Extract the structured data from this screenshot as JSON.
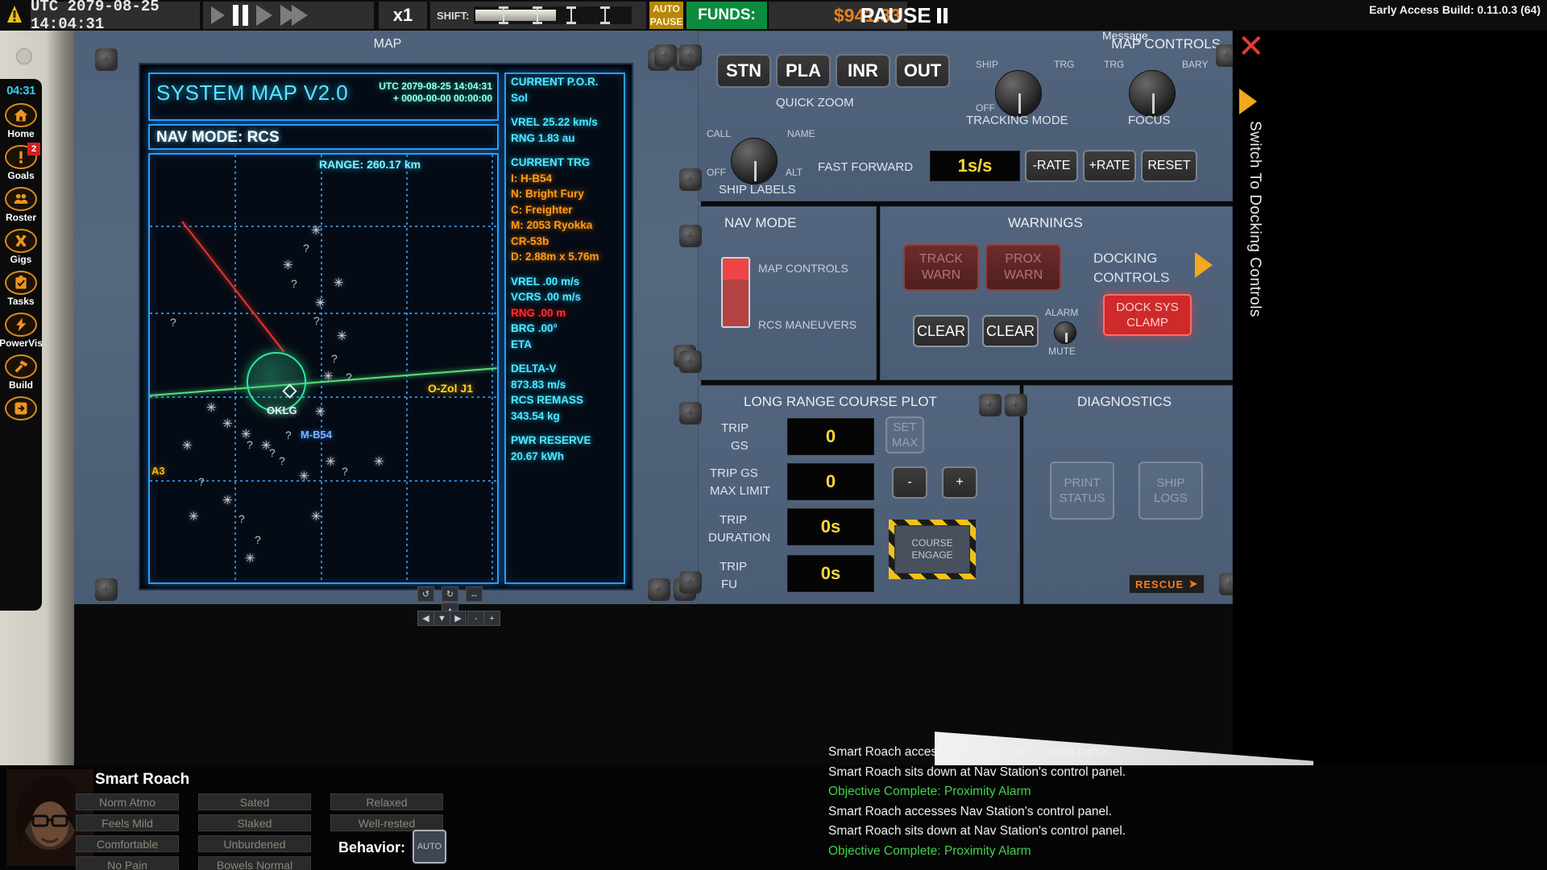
{
  "topbar": {
    "warn_icon": "warning-bell-icon",
    "clock": "UTC 2079-08-25 14:04:31",
    "speed": "x1",
    "shift_label": "SHIFT:",
    "auto_pause_line1": "AUTO",
    "auto_pause_line2": "PAUSE",
    "funds_label": "FUNDS:",
    "money": "$941.83",
    "pause_label": "PAUSE",
    "build": "Early Access Build: 0.11.0.3 (64)"
  },
  "sidebar": {
    "clock": "04:31",
    "items": [
      {
        "label": "Home",
        "icon": "home-icon",
        "badge": ""
      },
      {
        "label": "Goals",
        "icon": "exclamation-icon",
        "badge": "2"
      },
      {
        "label": "Roster",
        "icon": "people-icon",
        "badge": ""
      },
      {
        "label": "Gigs",
        "icon": "x-mark-icon",
        "badge": ""
      },
      {
        "label": "Tasks",
        "icon": "clipboard-check-icon",
        "badge": ""
      },
      {
        "label": "PowerVis",
        "icon": "lightning-icon",
        "badge": ""
      },
      {
        "label": "Build",
        "icon": "hammer-icon",
        "badge": ""
      },
      {
        "label": "",
        "icon": "exit-arrow-icon",
        "badge": ""
      }
    ]
  },
  "map": {
    "panel_title": "MAP",
    "screen_title": "SYSTEM MAP V2.0",
    "utc_tag": "UTC",
    "utc_value": "2079-08-25 14:04:31",
    "plus_tag": "+",
    "plus_value": "0000-00-00 00:00:00",
    "nav_mode": "NAV MODE: RCS",
    "range_label": "RANGE: 260.17 km",
    "labels": {
      "planet": "OKLG",
      "ship": "M-B54",
      "contact": "O-Zol J1",
      "corner": "A3"
    },
    "data": [
      {
        "text": "CURRENT P.O.R.",
        "color": "cyan"
      },
      {
        "text": "Sol",
        "color": "cyan"
      },
      {
        "gap": true
      },
      {
        "text": "VREL 25.22 km/s",
        "color": "cyan"
      },
      {
        "text": "RNG 1.83 au",
        "color": "cyan"
      },
      {
        "gap": true
      },
      {
        "text": "CURRENT TRG",
        "color": "cyan"
      },
      {
        "text": "I: H-B54",
        "color": "orange"
      },
      {
        "text": "N: Bright Fury",
        "color": "orange"
      },
      {
        "text": "C: Freighter",
        "color": "orange"
      },
      {
        "text": "M: 2053 Ryokka",
        "color": "orange"
      },
      {
        "text": "CR-53b",
        "color": "orange"
      },
      {
        "text": "D: 2.88m x 5.76m",
        "color": "orange"
      },
      {
        "gap": true
      },
      {
        "text": "VREL .00 m/s",
        "color": "cyan"
      },
      {
        "text": "VCRS .00 m/s",
        "color": "cyan"
      },
      {
        "text": "RNG .00 m",
        "color": "red"
      },
      {
        "text": "BRG .00°",
        "color": "cyan"
      },
      {
        "text": "ETA",
        "color": "cyan"
      },
      {
        "gap": true
      },
      {
        "text": "DELTA-V",
        "color": "cyan"
      },
      {
        "text": "873.83 m/s",
        "color": "cyan"
      },
      {
        "text": "RCS REMASS",
        "color": "cyan"
      },
      {
        "text": "343.54 kg",
        "color": "cyan"
      },
      {
        "gap": true
      },
      {
        "text": "PWR RESERVE",
        "color": "cyan"
      },
      {
        "text": "20.67 kWh",
        "color": "cyan"
      }
    ],
    "pad_buttons": [
      "↺",
      "↻",
      "↔",
      "◀",
      "▼",
      "▶",
      "-",
      "+"
    ],
    "pad_up": "▲"
  },
  "map_controls": {
    "title": "MAP CONTROLS",
    "quick_zoom_label": "QUICK ZOOM",
    "zoom_buttons": [
      "STN",
      "PLA",
      "INR",
      "OUT"
    ],
    "tracking_mode": {
      "title": "TRACKING MODE",
      "left": "SHIP",
      "right": "TRG",
      "bottom_left": "OFF"
    },
    "focus": {
      "title": "FOCUS",
      "left": "TRG",
      "right": "BARY"
    },
    "ship_labels": {
      "title": "SHIP LABELS",
      "left": "CALL",
      "right": "NAME",
      "bottom_left": "OFF",
      "bottom_right": "ALT"
    },
    "fast_forward_label": "FAST FORWARD",
    "rate_value": "1s/s",
    "rate_buttons": [
      "-RATE",
      "+RATE",
      "RESET"
    ]
  },
  "nav_mode_panel": {
    "title": "NAV MODE",
    "option_top": "MAP CONTROLS",
    "option_bottom": "RCS MANEUVERS"
  },
  "warnings": {
    "title": "WARNINGS",
    "warn_buttons": [
      {
        "line1": "TRACK",
        "line2": "WARN"
      },
      {
        "line1": "PROX",
        "line2": "WARN"
      }
    ],
    "clear_buttons": [
      "CLEAR",
      "CLEAR"
    ],
    "alarm_label": "ALARM",
    "mute_label": "MUTE",
    "docking_controls": "DOCKING\nCONTROLS",
    "docking_line1": "DOCKING",
    "docking_line2": "CONTROLS",
    "dock_sys_line1": "DOCK SYS",
    "dock_sys_line2": "CLAMP"
  },
  "course_plot": {
    "title": "LONG RANGE COURSE PLOT",
    "rows": [
      {
        "label_line1": "TRIP",
        "label_line2": "GS",
        "value": "0"
      },
      {
        "label_line1": "TRIP GS",
        "label_line2": "MAX LIMIT",
        "value": "0"
      },
      {
        "label_line1": "TRIP",
        "label_line2": "DURATION",
        "value": "0s"
      },
      {
        "label_line1": "TRIP",
        "label_line2": "FU",
        "value": "0s"
      }
    ],
    "set_max_line1": "SET",
    "set_max_line2": "MAX",
    "minus": "-",
    "plus": "+",
    "course_engage_line1": "COURSE",
    "course_engage_line2": "ENGAGE"
  },
  "diagnostics": {
    "title": "DIAGNOSTICS",
    "print_status_line1": "PRINT",
    "print_status_line2": "STATUS",
    "ship_logs_line1": "SHIP",
    "ship_logs_line2": "LOGS",
    "rescue": "RESCUE"
  },
  "right_strip": {
    "message_label": "Message",
    "close": "✕",
    "switch_label": "Switch To Docking Controls"
  },
  "character": {
    "name": "Smart Roach",
    "stats_col1": [
      "Norm Atmo",
      "Feels Mild",
      "Comfortable",
      "No Pain"
    ],
    "stats_col2": [
      "Sated",
      "Slaked",
      "Unburdened",
      "Bowels Normal"
    ],
    "stats_col3": [
      "Relaxed",
      "Well-rested"
    ],
    "behavior_label": "Behavior:",
    "behavior_value": "AUTO"
  },
  "log": [
    {
      "text": "Smart Roach accesses Nav Station's control panel.",
      "color": "white"
    },
    {
      "text": "Smart Roach sits down at Nav Station's control panel.",
      "color": "white"
    },
    {
      "text": "Objective Complete: Proximity Alarm",
      "color": "green"
    },
    {
      "text": "Smart Roach accesses Nav Station's control panel.",
      "color": "white"
    },
    {
      "text": "Smart Roach sits down at Nav Station's control panel.",
      "color": "white"
    },
    {
      "text": "Objective Complete: Proximity Alarm",
      "color": "green"
    }
  ],
  "colors": {
    "accent_orange": "#f0941e",
    "neon_cyan": "#52e7ff",
    "neon_blue": "#2a9dfc",
    "warn_red": "#cf2a2a",
    "funds_green": "#0b8b3e",
    "panel_blue": "#53657e"
  }
}
